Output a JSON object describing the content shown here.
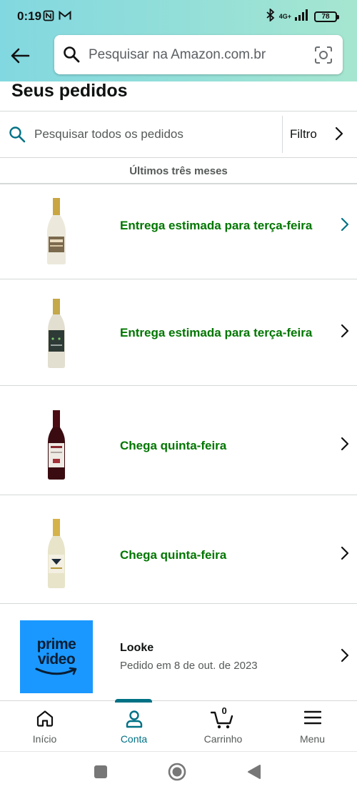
{
  "status_bar": {
    "time": "0:19",
    "network": "4G+",
    "battery": "78"
  },
  "header": {
    "search_placeholder": "Pesquisar na Amazon.com.br"
  },
  "page": {
    "title": "Seus pedidos"
  },
  "orders_search": {
    "placeholder": "Pesquisar todos os pedidos",
    "filter_label": "Filtro"
  },
  "range_label": "Últimos três meses",
  "orders": [
    {
      "status": "Entrega estimada para terça-feira",
      "image": "sparkling-white-wine-bottle"
    },
    {
      "status": "Entrega estimada para terça-feira",
      "image": "white-wine-bottle"
    },
    {
      "status": "Chega quinta-feira",
      "image": "red-wine-bottle"
    },
    {
      "status": "Chega quinta-feira",
      "image": "sparkling-wine-bottle"
    }
  ],
  "digital_order": {
    "title": "Looke",
    "subtitle": "Pedido em 8 de out. de 2023",
    "tile_line1": "prime",
    "tile_line2": "video"
  },
  "bottom_nav": {
    "items": [
      {
        "label": "Início",
        "icon": "home-icon"
      },
      {
        "label": "Conta",
        "icon": "account-icon",
        "active": true
      },
      {
        "label": "Carrinho",
        "icon": "cart-icon",
        "count": "0"
      },
      {
        "label": "Menu",
        "icon": "menu-icon"
      }
    ]
  },
  "colors": {
    "header_gradient_start": "#82d8e0",
    "header_gradient_end": "#a6e6d0",
    "delivery_status": "#007600",
    "accent_teal": "#007185",
    "prime_blue": "#1a98ff"
  }
}
